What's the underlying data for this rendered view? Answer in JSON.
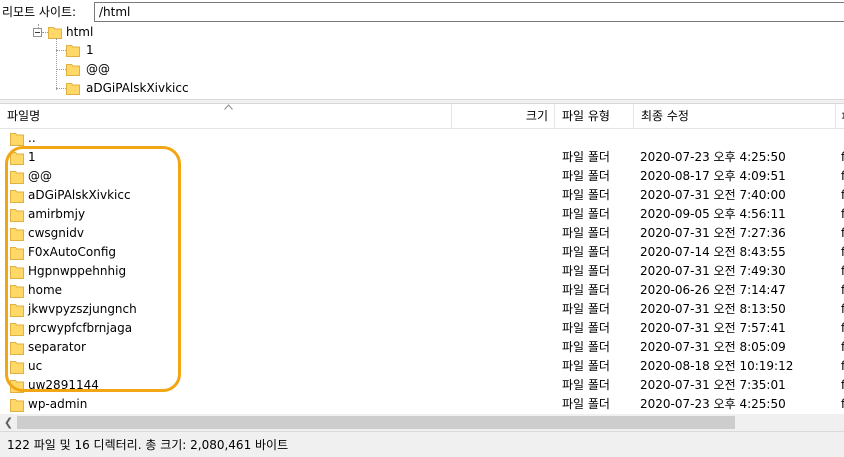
{
  "remote_site": {
    "label": "리모트 사이트:",
    "path": "/html"
  },
  "tree": {
    "root": "html",
    "children": [
      "1",
      "@@",
      "aDGiPAlskXivkicc"
    ]
  },
  "columns": {
    "name": "파일명",
    "size": "크기",
    "type": "파일 유형",
    "modified": "최종 수정",
    "permissions": "ㅍ"
  },
  "files": [
    {
      "name": "..",
      "type": "",
      "modified": "",
      "perm": ""
    },
    {
      "name": "1",
      "type": "파일 폴더",
      "modified": "2020-07-23 오후 4:25:50",
      "perm": "f"
    },
    {
      "name": "@@",
      "type": "파일 폴더",
      "modified": "2020-08-17 오후 4:09:51",
      "perm": "f"
    },
    {
      "name": "aDGiPAlskXivkicc",
      "type": "파일 폴더",
      "modified": "2020-07-31 오전 7:40:00",
      "perm": "f"
    },
    {
      "name": "amirbmjy",
      "type": "파일 폴더",
      "modified": "2020-09-05 오후 4:56:11",
      "perm": "f"
    },
    {
      "name": "cwsgnidv",
      "type": "파일 폴더",
      "modified": "2020-07-31 오전 7:27:36",
      "perm": "f"
    },
    {
      "name": "F0xAutoConfig",
      "type": "파일 폴더",
      "modified": "2020-07-14 오전 8:43:55",
      "perm": "f"
    },
    {
      "name": "Hgpnwppehnhig",
      "type": "파일 폴더",
      "modified": "2020-07-31 오전 7:49:30",
      "perm": "f"
    },
    {
      "name": "home",
      "type": "파일 폴더",
      "modified": "2020-06-26 오전 7:14:47",
      "perm": "f"
    },
    {
      "name": "jkwvpyzszjungnch",
      "type": "파일 폴더",
      "modified": "2020-07-31 오전 8:13:50",
      "perm": "f"
    },
    {
      "name": "prcwypfcfbrnjaga",
      "type": "파일 폴더",
      "modified": "2020-07-31 오전 7:57:41",
      "perm": "f"
    },
    {
      "name": "separator",
      "type": "파일 폴더",
      "modified": "2020-07-31 오전 8:05:09",
      "perm": "f"
    },
    {
      "name": "uc",
      "type": "파일 폴더",
      "modified": "2020-08-18 오전 10:19:12",
      "perm": "f"
    },
    {
      "name": "uw2891144",
      "type": "파일 폴더",
      "modified": "2020-07-31 오전 7:35:01",
      "perm": "f"
    },
    {
      "name": "wp-admin",
      "type": "파일 폴더",
      "modified": "2020-07-23 오후 4:25:50",
      "perm": "f"
    }
  ],
  "status": "122 파일 및 16 디렉터리. 총 크기: 2,080,461 바이트",
  "colors": {
    "folder_fill": "#ffd867",
    "folder_edge": "#e0b040",
    "highlight": "#f2a613"
  },
  "icons": {
    "folder": "folder-icon",
    "collapse": "collapse-icon",
    "sort": "sort-ascending-icon",
    "scroll_left": "scroll-left-icon"
  }
}
